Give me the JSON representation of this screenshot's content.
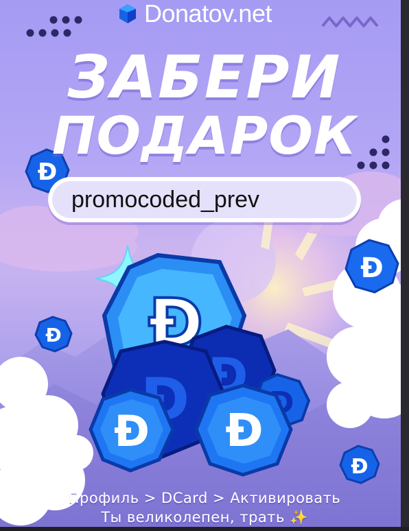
{
  "logo": {
    "text": "Donatov.net",
    "icon": "donatov-gem-logo-icon"
  },
  "headline": {
    "line1": "ЗАБЕРИ",
    "line2": "ПОДАРОК"
  },
  "promo": {
    "code": "promocoded_prev"
  },
  "coin": {
    "glyph": "Đ",
    "icon": "dcard-coin-icon"
  },
  "caption": {
    "path": "Профиль > DCard > Активировать",
    "tagline": "Ты великолепен, трать ✨"
  },
  "colors": {
    "background_top": "#a59bf3",
    "background_glow": "#cbb5f0",
    "coin_blue": "#1763e8",
    "coin_deep": "#0d2fb8",
    "coin_light": "#38c6ff",
    "sparkle": "#8ff6ff",
    "dots": "#2c2866",
    "wave": "#7a66c8"
  }
}
